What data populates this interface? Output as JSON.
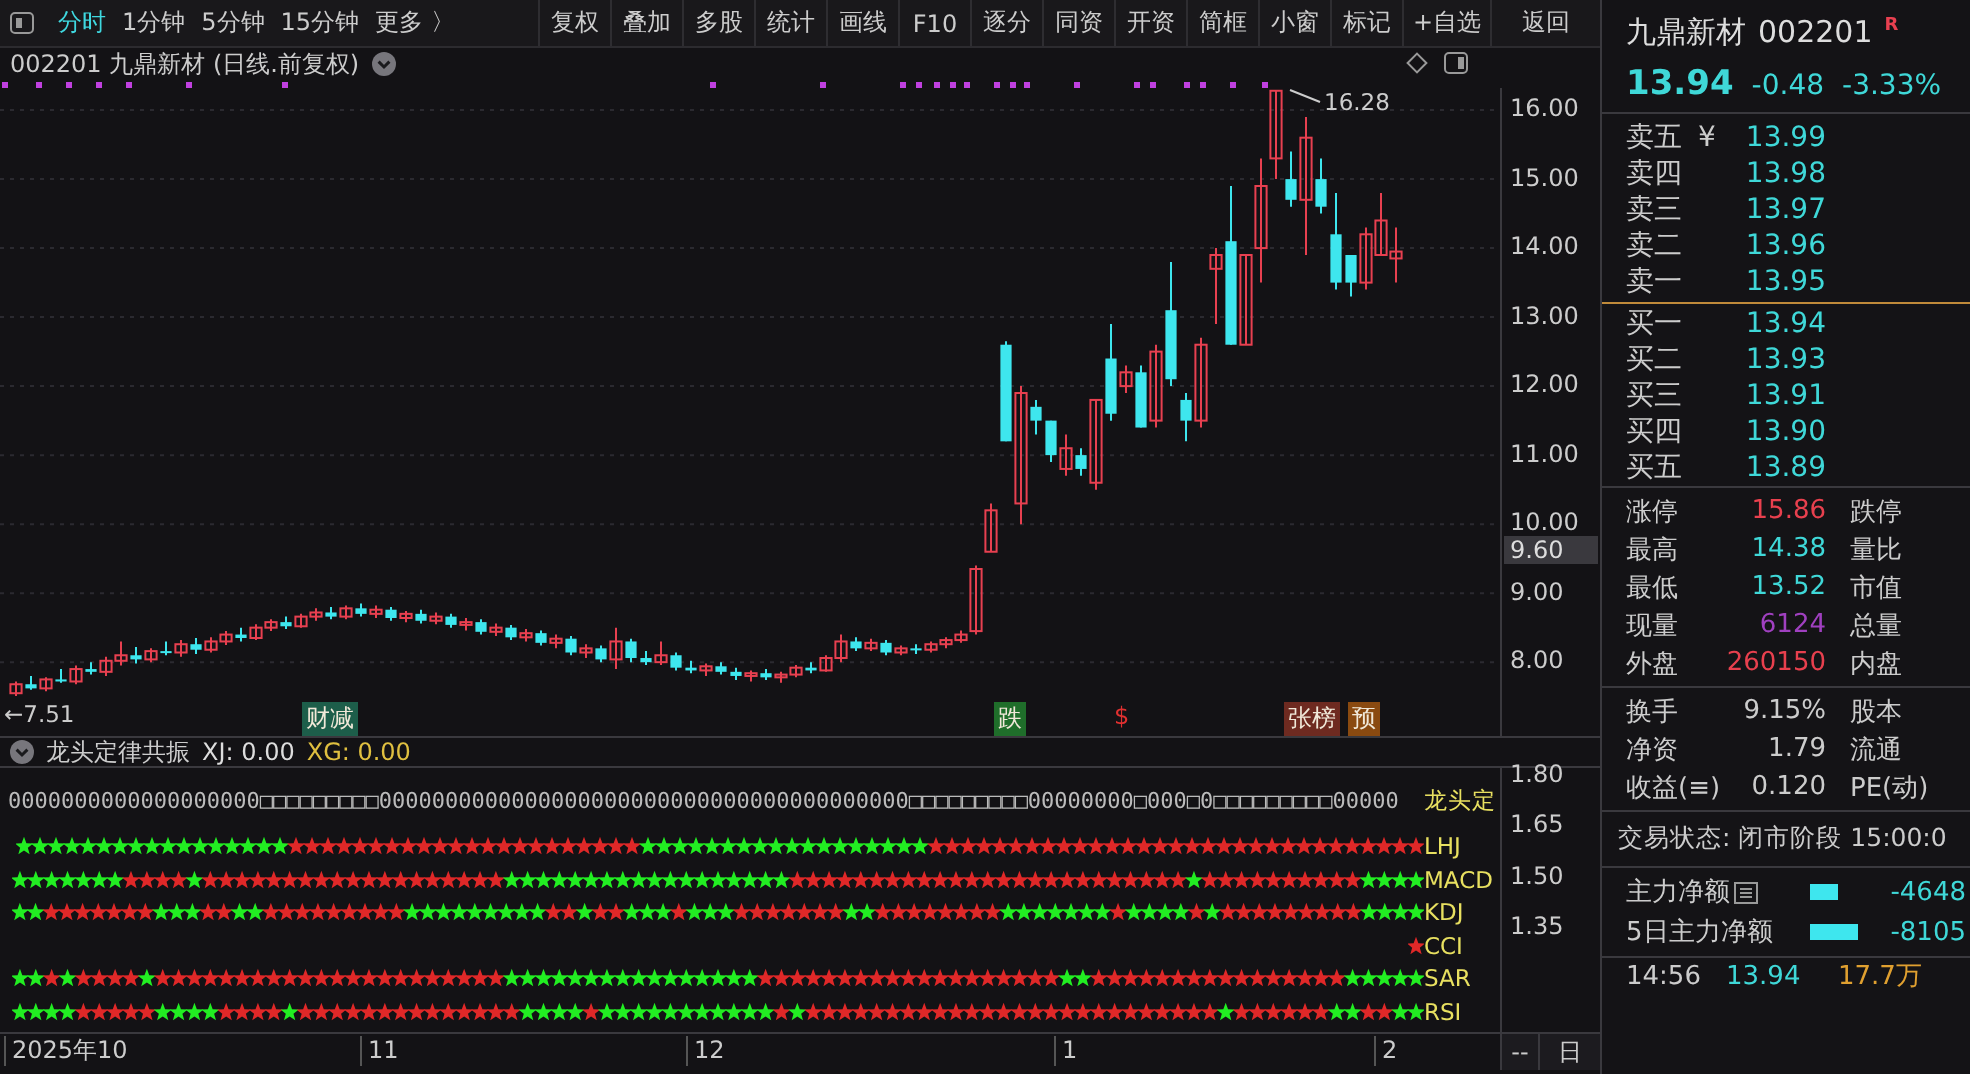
{
  "toolbar": {
    "period_tabs": [
      {
        "label": "分时",
        "selected": true
      },
      {
        "label": "1分钟",
        "selected": false
      },
      {
        "label": "5分钟",
        "selected": false
      },
      {
        "label": "15分钟",
        "selected": false
      }
    ],
    "more": "更多 〉",
    "buttons": [
      "复权",
      "叠加",
      "多股",
      "统计",
      "画线",
      "F10",
      "逐分",
      "同资",
      "开资",
      "简框",
      "小窗",
      "标记",
      "+自选"
    ],
    "back": "返回"
  },
  "chart": {
    "title": "002201 九鼎新材 (日线.前复权)",
    "current_price_tag": "9.60",
    "high_label": "16.28",
    "low_label": "←7.51",
    "chart_data": {
      "type": "candlestick",
      "ylim": [
        6.93,
        16.32
      ],
      "grid": true,
      "ohlc": [
        [
          7.55,
          7.72,
          7.51,
          7.68
        ],
        [
          7.68,
          7.8,
          7.6,
          7.62
        ],
        [
          7.62,
          7.78,
          7.58,
          7.75
        ],
        [
          7.75,
          7.9,
          7.7,
          7.72
        ],
        [
          7.72,
          7.95,
          7.68,
          7.9
        ],
        [
          7.9,
          8.0,
          7.82,
          7.86
        ],
        [
          7.86,
          8.08,
          7.8,
          8.02
        ],
        [
          8.02,
          8.3,
          7.95,
          8.1
        ],
        [
          8.1,
          8.22,
          7.98,
          8.04
        ],
        [
          8.04,
          8.2,
          8.0,
          8.16
        ],
        [
          8.16,
          8.3,
          8.1,
          8.14
        ],
        [
          8.14,
          8.32,
          8.08,
          8.26
        ],
        [
          8.26,
          8.35,
          8.12,
          8.18
        ],
        [
          8.18,
          8.36,
          8.14,
          8.3
        ],
        [
          8.3,
          8.45,
          8.25,
          8.4
        ],
        [
          8.4,
          8.5,
          8.3,
          8.35
        ],
        [
          8.35,
          8.55,
          8.32,
          8.5
        ],
        [
          8.5,
          8.62,
          8.45,
          8.58
        ],
        [
          8.58,
          8.66,
          8.48,
          8.52
        ],
        [
          8.52,
          8.7,
          8.5,
          8.66
        ],
        [
          8.66,
          8.78,
          8.6,
          8.72
        ],
        [
          8.72,
          8.8,
          8.62,
          8.66
        ],
        [
          8.66,
          8.82,
          8.62,
          8.78
        ],
        [
          8.78,
          8.85,
          8.66,
          8.7
        ],
        [
          8.7,
          8.82,
          8.64,
          8.76
        ],
        [
          8.76,
          8.8,
          8.6,
          8.64
        ],
        [
          8.64,
          8.74,
          8.58,
          8.7
        ],
        [
          8.7,
          8.76,
          8.56,
          8.6
        ],
        [
          8.6,
          8.72,
          8.55,
          8.66
        ],
        [
          8.66,
          8.7,
          8.5,
          8.54
        ],
        [
          8.54,
          8.64,
          8.46,
          8.58
        ],
        [
          8.58,
          8.62,
          8.4,
          8.44
        ],
        [
          8.44,
          8.56,
          8.38,
          8.5
        ],
        [
          8.5,
          8.54,
          8.32,
          8.36
        ],
        [
          8.36,
          8.48,
          8.3,
          8.42
        ],
        [
          8.42,
          8.46,
          8.24,
          8.28
        ],
        [
          8.28,
          8.4,
          8.2,
          8.34
        ],
        [
          8.34,
          8.38,
          8.1,
          8.14
        ],
        [
          8.14,
          8.26,
          8.06,
          8.2
        ],
        [
          8.2,
          8.24,
          8.0,
          8.04
        ],
        [
          8.04,
          8.5,
          7.9,
          8.3
        ],
        [
          8.3,
          8.34,
          8.0,
          8.06
        ],
        [
          8.06,
          8.16,
          7.96,
          8.0
        ],
        [
          8.0,
          8.3,
          7.96,
          8.1
        ],
        [
          8.1,
          8.14,
          7.88,
          7.92
        ],
        [
          7.92,
          8.02,
          7.84,
          7.88
        ],
        [
          7.88,
          7.98,
          7.8,
          7.94
        ],
        [
          7.94,
          8.0,
          7.82,
          7.86
        ],
        [
          7.86,
          7.92,
          7.74,
          7.8
        ],
        [
          7.8,
          7.88,
          7.72,
          7.84
        ],
        [
          7.84,
          7.9,
          7.74,
          7.78
        ],
        [
          7.78,
          7.86,
          7.7,
          7.82
        ],
        [
          7.82,
          7.96,
          7.78,
          7.92
        ],
        [
          7.92,
          8.0,
          7.84,
          7.88
        ],
        [
          7.88,
          8.1,
          7.86,
          8.06
        ],
        [
          8.06,
          8.4,
          8.0,
          8.3
        ],
        [
          8.3,
          8.36,
          8.16,
          8.2
        ],
        [
          8.2,
          8.34,
          8.16,
          8.28
        ],
        [
          8.28,
          8.32,
          8.1,
          8.14
        ],
        [
          8.14,
          8.24,
          8.1,
          8.2
        ],
        [
          8.2,
          8.26,
          8.12,
          8.18
        ],
        [
          8.18,
          8.3,
          8.14,
          8.26
        ],
        [
          8.26,
          8.36,
          8.2,
          8.32
        ],
        [
          8.32,
          8.46,
          8.28,
          8.4
        ],
        [
          8.45,
          9.4,
          8.4,
          9.35
        ],
        [
          9.6,
          10.3,
          9.6,
          10.2
        ],
        [
          12.6,
          12.65,
          11.2,
          11.2
        ],
        [
          10.3,
          12.0,
          10.0,
          11.9
        ],
        [
          11.7,
          11.8,
          11.3,
          11.5
        ],
        [
          11.5,
          11.5,
          10.9,
          11.0
        ],
        [
          10.8,
          11.3,
          10.7,
          11.1
        ],
        [
          11.0,
          11.1,
          10.7,
          10.8
        ],
        [
          10.6,
          11.8,
          10.5,
          11.8
        ],
        [
          12.4,
          12.9,
          11.5,
          11.6
        ],
        [
          12.0,
          12.3,
          11.9,
          12.2
        ],
        [
          12.2,
          12.3,
          11.4,
          11.4
        ],
        [
          11.5,
          12.6,
          11.4,
          12.5
        ],
        [
          13.1,
          13.8,
          12.0,
          12.1
        ],
        [
          11.8,
          11.9,
          11.2,
          11.5
        ],
        [
          11.5,
          12.7,
          11.4,
          12.6
        ],
        [
          13.7,
          14.0,
          12.9,
          13.9
        ],
        [
          14.1,
          14.9,
          12.6,
          12.6
        ],
        [
          12.6,
          13.9,
          12.6,
          13.9
        ],
        [
          14.0,
          15.3,
          13.5,
          14.9
        ],
        [
          15.3,
          16.28,
          15.0,
          16.28
        ],
        [
          15.0,
          15.4,
          14.6,
          14.7
        ],
        [
          14.7,
          15.9,
          13.9,
          15.6
        ],
        [
          15.0,
          15.3,
          14.5,
          14.6
        ],
        [
          14.2,
          14.8,
          13.4,
          13.5
        ],
        [
          13.9,
          13.9,
          13.3,
          13.5
        ],
        [
          13.5,
          14.3,
          13.4,
          14.2
        ],
        [
          13.9,
          14.8,
          13.9,
          14.4
        ],
        [
          13.85,
          14.3,
          13.5,
          13.95
        ]
      ],
      "yticks": [
        {
          "value": 16,
          "label": "16.00"
        },
        {
          "value": 15,
          "label": "15.00"
        },
        {
          "value": 14,
          "label": "14.00"
        },
        {
          "value": 13,
          "label": "13.00"
        },
        {
          "value": 12,
          "label": "12.00"
        },
        {
          "value": 11,
          "label": "11.00"
        },
        {
          "value": 10,
          "label": "10.00"
        },
        {
          "value": 9,
          "label": "9.00"
        },
        {
          "value": 8,
          "label": "8.00"
        }
      ]
    },
    "markers": [
      {
        "kind": "tag",
        "label": "财减",
        "color": "#1d5e4a"
      },
      {
        "kind": "tag",
        "label": "跌",
        "color": "#1f6e2a"
      },
      {
        "kind": "symbol",
        "label": "$",
        "color": "#e03030"
      },
      {
        "kind": "tag",
        "label": "张榜",
        "color": "#6e2a20"
      },
      {
        "kind": "tag",
        "label": "预",
        "color": "#8a4a10"
      }
    ]
  },
  "indicator": {
    "name": "龙头定律共振",
    "values": [
      {
        "kind": "plain",
        "text": "XJ: 0.00"
      },
      {
        "kind": "signal",
        "text": "XG: 0.00"
      }
    ],
    "zero_row": {
      "text": "0000000000000000000□□□□□□□□□0000000000000000000000000000000000000000□□□□□□□□□00000000□000□0□□□□□□□□□00000",
      "label": "龙头定"
    },
    "rows": [
      {
        "label": "LHJ",
        "signals": [
          {
            "color": "#22ee22"
          },
          {
            "color": "#22ee22"
          },
          {
            "color": "#22ee22"
          },
          {
            "color": "#22ee22"
          },
          {
            "color": "#22ee22"
          },
          {
            "color": "#22ee22"
          },
          {
            "color": "#22ee22"
          },
          {
            "color": "#22ee22"
          },
          {
            "color": "#22ee22"
          },
          {
            "color": "#22ee22"
          },
          {
            "color": "#22ee22"
          },
          {
            "color": "#22ee22"
          },
          {
            "color": "#22ee22"
          },
          {
            "color": "#22ee22"
          },
          {
            "color": "#22ee22"
          },
          {
            "color": "#22ee22"
          },
          {
            "color": "#22ee22"
          },
          {
            "color": "#e02828"
          },
          {
            "color": "#e02828"
          },
          {
            "color": "#e02828"
          },
          {
            "color": "#e02828"
          },
          {
            "color": "#e02828"
          },
          {
            "color": "#e02828"
          },
          {
            "color": "#e02828"
          },
          {
            "color": "#e02828"
          },
          {
            "color": "#e02828"
          },
          {
            "color": "#e02828"
          },
          {
            "color": "#e02828"
          },
          {
            "color": "#e02828"
          },
          {
            "color": "#e02828"
          },
          {
            "color": "#e02828"
          },
          {
            "color": "#e02828"
          },
          {
            "color": "#e02828"
          },
          {
            "color": "#e02828"
          },
          {
            "color": "#e02828"
          },
          {
            "color": "#e02828"
          },
          {
            "color": "#e02828"
          },
          {
            "color": "#e02828"
          },
          {
            "color": "#e02828"
          },
          {
            "color": "#22ee22"
          },
          {
            "color": "#22ee22"
          },
          {
            "color": "#22ee22"
          },
          {
            "color": "#22ee22"
          },
          {
            "color": "#22ee22"
          },
          {
            "color": "#22ee22"
          },
          {
            "color": "#22ee22"
          },
          {
            "color": "#22ee22"
          },
          {
            "color": "#22ee22"
          },
          {
            "color": "#22ee22"
          },
          {
            "color": "#22ee22"
          },
          {
            "color": "#22ee22"
          },
          {
            "color": "#22ee22"
          },
          {
            "color": "#22ee22"
          },
          {
            "color": "#22ee22"
          },
          {
            "color": "#22ee22"
          },
          {
            "color": "#22ee22"
          },
          {
            "color": "#22ee22"
          },
          {
            "color": "#e02828"
          },
          {
            "color": "#e02828"
          },
          {
            "color": "#e02828"
          },
          {
            "color": "#e02828"
          },
          {
            "color": "#e02828"
          },
          {
            "color": "#e02828"
          },
          {
            "color": "#e02828"
          },
          {
            "color": "#e02828"
          },
          {
            "color": "#e02828"
          },
          {
            "color": "#e02828"
          },
          {
            "color": "#e02828"
          },
          {
            "color": "#e02828"
          },
          {
            "color": "#e02828"
          },
          {
            "color": "#e02828"
          },
          {
            "color": "#e02828"
          },
          {
            "color": "#e02828"
          },
          {
            "color": "#e02828"
          },
          {
            "color": "#e02828"
          },
          {
            "color": "#e02828"
          },
          {
            "color": "#e02828"
          },
          {
            "color": "#e02828"
          },
          {
            "color": "#e02828"
          },
          {
            "color": "#e02828"
          },
          {
            "color": "#e02828"
          },
          {
            "color": "#e02828"
          },
          {
            "color": "#e02828"
          },
          {
            "color": "#e02828"
          },
          {
            "color": "#e02828"
          },
          {
            "color": "#e02828"
          },
          {
            "color": "#e02828"
          },
          {
            "color": "#e02828"
          }
        ]
      },
      {
        "label": "MACD",
        "signals": [
          {
            "color": "#22ee22"
          },
          {
            "color": "#22ee22"
          },
          {
            "color": "#22ee22"
          },
          {
            "color": "#22ee22"
          },
          {
            "color": "#22ee22"
          },
          {
            "color": "#22ee22"
          },
          {
            "color": "#22ee22"
          },
          {
            "color": "#e02828"
          },
          {
            "color": "#e02828"
          },
          {
            "color": "#e02828"
          },
          {
            "color": "#e02828"
          },
          {
            "color": "#22ee22"
          },
          {
            "color": "#e02828"
          },
          {
            "color": "#e02828"
          },
          {
            "color": "#e02828"
          },
          {
            "color": "#e02828"
          },
          {
            "color": "#e02828"
          },
          {
            "color": "#e02828"
          },
          {
            "color": "#e02828"
          },
          {
            "color": "#e02828"
          },
          {
            "color": "#e02828"
          },
          {
            "color": "#e02828"
          },
          {
            "color": "#e02828"
          },
          {
            "color": "#e02828"
          },
          {
            "color": "#e02828"
          },
          {
            "color": "#e02828"
          },
          {
            "color": "#e02828"
          },
          {
            "color": "#e02828"
          },
          {
            "color": "#e02828"
          },
          {
            "color": "#e02828"
          },
          {
            "color": "#e02828"
          },
          {
            "color": "#22ee22"
          },
          {
            "color": "#22ee22"
          },
          {
            "color": "#22ee22"
          },
          {
            "color": "#22ee22"
          },
          {
            "color": "#22ee22"
          },
          {
            "color": "#22ee22"
          },
          {
            "color": "#22ee22"
          },
          {
            "color": "#22ee22"
          },
          {
            "color": "#22ee22"
          },
          {
            "color": "#22ee22"
          },
          {
            "color": "#22ee22"
          },
          {
            "color": "#22ee22"
          },
          {
            "color": "#22ee22"
          },
          {
            "color": "#22ee22"
          },
          {
            "color": "#22ee22"
          },
          {
            "color": "#22ee22"
          },
          {
            "color": "#22ee22"
          },
          {
            "color": "#22ee22"
          },
          {
            "color": "#e02828"
          },
          {
            "color": "#e02828"
          },
          {
            "color": "#e02828"
          },
          {
            "color": "#e02828"
          },
          {
            "color": "#e02828"
          },
          {
            "color": "#e02828"
          },
          {
            "color": "#e02828"
          },
          {
            "color": "#e02828"
          },
          {
            "color": "#e02828"
          },
          {
            "color": "#e02828"
          },
          {
            "color": "#e02828"
          },
          {
            "color": "#e02828"
          },
          {
            "color": "#e02828"
          },
          {
            "color": "#e02828"
          },
          {
            "color": "#e02828"
          },
          {
            "color": "#e02828"
          },
          {
            "color": "#e02828"
          },
          {
            "color": "#e02828"
          },
          {
            "color": "#e02828"
          },
          {
            "color": "#e02828"
          },
          {
            "color": "#e02828"
          },
          {
            "color": "#e02828"
          },
          {
            "color": "#e02828"
          },
          {
            "color": "#e02828"
          },
          {
            "color": "#e02828"
          },
          {
            "color": "#22ee22"
          },
          {
            "color": "#e02828"
          },
          {
            "color": "#e02828"
          },
          {
            "color": "#e02828"
          },
          {
            "color": "#e02828"
          },
          {
            "color": "#e02828"
          },
          {
            "color": "#e02828"
          },
          {
            "color": "#e02828"
          },
          {
            "color": "#e02828"
          },
          {
            "color": "#e02828"
          },
          {
            "color": "#e02828"
          },
          {
            "color": "#22ee22"
          },
          {
            "color": "#22ee22"
          },
          {
            "color": "#22ee22"
          },
          {
            "color": "#22ee22"
          }
        ]
      },
      {
        "label": "KDJ",
        "signals": [
          {
            "color": "#22ee22"
          },
          {
            "color": "#22ee22"
          },
          {
            "color": "#e02828"
          },
          {
            "color": "#e02828"
          },
          {
            "color": "#e02828"
          },
          {
            "color": "#e02828"
          },
          {
            "color": "#e02828"
          },
          {
            "color": "#e02828"
          },
          {
            "color": "#e02828"
          },
          {
            "color": "#22ee22"
          },
          {
            "color": "#22ee22"
          },
          {
            "color": "#22ee22"
          },
          {
            "color": "#e02828"
          },
          {
            "color": "#e02828"
          },
          {
            "color": "#22ee22"
          },
          {
            "color": "#22ee22"
          },
          {
            "color": "#e02828"
          },
          {
            "color": "#e02828"
          },
          {
            "color": "#e02828"
          },
          {
            "color": "#e02828"
          },
          {
            "color": "#e02828"
          },
          {
            "color": "#e02828"
          },
          {
            "color": "#e02828"
          },
          {
            "color": "#e02828"
          },
          {
            "color": "#e02828"
          },
          {
            "color": "#22ee22"
          },
          {
            "color": "#22ee22"
          },
          {
            "color": "#22ee22"
          },
          {
            "color": "#22ee22"
          },
          {
            "color": "#22ee22"
          },
          {
            "color": "#22ee22"
          },
          {
            "color": "#22ee22"
          },
          {
            "color": "#22ee22"
          },
          {
            "color": "#22ee22"
          },
          {
            "color": "#e02828"
          },
          {
            "color": "#e02828"
          },
          {
            "color": "#22ee22"
          },
          {
            "color": "#e02828"
          },
          {
            "color": "#e02828"
          },
          {
            "color": "#22ee22"
          },
          {
            "color": "#22ee22"
          },
          {
            "color": "#22ee22"
          },
          {
            "color": "#e02828"
          },
          {
            "color": "#22ee22"
          },
          {
            "color": "#22ee22"
          },
          {
            "color": "#22ee22"
          },
          {
            "color": "#e02828"
          },
          {
            "color": "#e02828"
          },
          {
            "color": "#e02828"
          },
          {
            "color": "#e02828"
          },
          {
            "color": "#e02828"
          },
          {
            "color": "#e02828"
          },
          {
            "color": "#e02828"
          },
          {
            "color": "#22ee22"
          },
          {
            "color": "#22ee22"
          },
          {
            "color": "#e02828"
          },
          {
            "color": "#e02828"
          },
          {
            "color": "#e02828"
          },
          {
            "color": "#e02828"
          },
          {
            "color": "#e02828"
          },
          {
            "color": "#e02828"
          },
          {
            "color": "#e02828"
          },
          {
            "color": "#e02828"
          },
          {
            "color": "#22ee22"
          },
          {
            "color": "#22ee22"
          },
          {
            "color": "#22ee22"
          },
          {
            "color": "#22ee22"
          },
          {
            "color": "#22ee22"
          },
          {
            "color": "#22ee22"
          },
          {
            "color": "#22ee22"
          },
          {
            "color": "#e02828"
          },
          {
            "color": "#22ee22"
          },
          {
            "color": "#22ee22"
          },
          {
            "color": "#22ee22"
          },
          {
            "color": "#22ee22"
          },
          {
            "color": "#e02828"
          },
          {
            "color": "#22ee22"
          },
          {
            "color": "#e02828"
          },
          {
            "color": "#e02828"
          },
          {
            "color": "#e02828"
          },
          {
            "color": "#e02828"
          },
          {
            "color": "#e02828"
          },
          {
            "color": "#e02828"
          },
          {
            "color": "#e02828"
          },
          {
            "color": "#e02828"
          },
          {
            "color": "#e02828"
          },
          {
            "color": "#22ee22"
          },
          {
            "color": "#22ee22"
          },
          {
            "color": "#22ee22"
          },
          {
            "color": "#22ee22"
          }
        ]
      },
      {
        "label": "CCI",
        "signals": [
          {
            "color": "#e02828"
          }
        ]
      },
      {
        "label": "SAR",
        "signals": [
          {
            "color": "#22ee22"
          },
          {
            "color": "#22ee22"
          },
          {
            "color": "#e02828"
          },
          {
            "color": "#22ee22"
          },
          {
            "color": "#e02828"
          },
          {
            "color": "#e02828"
          },
          {
            "color": "#e02828"
          },
          {
            "color": "#e02828"
          },
          {
            "color": "#22ee22"
          },
          {
            "color": "#e02828"
          },
          {
            "color": "#e02828"
          },
          {
            "color": "#e02828"
          },
          {
            "color": "#e02828"
          },
          {
            "color": "#e02828"
          },
          {
            "color": "#e02828"
          },
          {
            "color": "#e02828"
          },
          {
            "color": "#e02828"
          },
          {
            "color": "#e02828"
          },
          {
            "color": "#e02828"
          },
          {
            "color": "#e02828"
          },
          {
            "color": "#e02828"
          },
          {
            "color": "#e02828"
          },
          {
            "color": "#e02828"
          },
          {
            "color": "#e02828"
          },
          {
            "color": "#e02828"
          },
          {
            "color": "#e02828"
          },
          {
            "color": "#e02828"
          },
          {
            "color": "#e02828"
          },
          {
            "color": "#e02828"
          },
          {
            "color": "#e02828"
          },
          {
            "color": "#e02828"
          },
          {
            "color": "#22ee22"
          },
          {
            "color": "#22ee22"
          },
          {
            "color": "#22ee22"
          },
          {
            "color": "#22ee22"
          },
          {
            "color": "#22ee22"
          },
          {
            "color": "#22ee22"
          },
          {
            "color": "#22ee22"
          },
          {
            "color": "#22ee22"
          },
          {
            "color": "#22ee22"
          },
          {
            "color": "#22ee22"
          },
          {
            "color": "#22ee22"
          },
          {
            "color": "#22ee22"
          },
          {
            "color": "#22ee22"
          },
          {
            "color": "#22ee22"
          },
          {
            "color": "#22ee22"
          },
          {
            "color": "#22ee22"
          },
          {
            "color": "#e02828"
          },
          {
            "color": "#e02828"
          },
          {
            "color": "#e02828"
          },
          {
            "color": "#e02828"
          },
          {
            "color": "#e02828"
          },
          {
            "color": "#e02828"
          },
          {
            "color": "#e02828"
          },
          {
            "color": "#e02828"
          },
          {
            "color": "#e02828"
          },
          {
            "color": "#e02828"
          },
          {
            "color": "#e02828"
          },
          {
            "color": "#e02828"
          },
          {
            "color": "#e02828"
          },
          {
            "color": "#e02828"
          },
          {
            "color": "#e02828"
          },
          {
            "color": "#e02828"
          },
          {
            "color": "#e02828"
          },
          {
            "color": "#e02828"
          },
          {
            "color": "#e02828"
          },
          {
            "color": "#22ee22"
          },
          {
            "color": "#22ee22"
          },
          {
            "color": "#e02828"
          },
          {
            "color": "#e02828"
          },
          {
            "color": "#e02828"
          },
          {
            "color": "#e02828"
          },
          {
            "color": "#e02828"
          },
          {
            "color": "#e02828"
          },
          {
            "color": "#e02828"
          },
          {
            "color": "#e02828"
          },
          {
            "color": "#e02828"
          },
          {
            "color": "#e02828"
          },
          {
            "color": "#e02828"
          },
          {
            "color": "#e02828"
          },
          {
            "color": "#e02828"
          },
          {
            "color": "#e02828"
          },
          {
            "color": "#e02828"
          },
          {
            "color": "#e02828"
          },
          {
            "color": "#22ee22"
          },
          {
            "color": "#22ee22"
          },
          {
            "color": "#22ee22"
          },
          {
            "color": "#22ee22"
          },
          {
            "color": "#22ee22"
          }
        ]
      },
      {
        "label": "RSI",
        "signals": [
          {
            "color": "#22ee22"
          },
          {
            "color": "#22ee22"
          },
          {
            "color": "#22ee22"
          },
          {
            "color": "#22ee22"
          },
          {
            "color": "#e02828"
          },
          {
            "color": "#e02828"
          },
          {
            "color": "#e02828"
          },
          {
            "color": "#e02828"
          },
          {
            "color": "#e02828"
          },
          {
            "color": "#22ee22"
          },
          {
            "color": "#22ee22"
          },
          {
            "color": "#22ee22"
          },
          {
            "color": "#22ee22"
          },
          {
            "color": "#e02828"
          },
          {
            "color": "#e02828"
          },
          {
            "color": "#e02828"
          },
          {
            "color": "#e02828"
          },
          {
            "color": "#22ee22"
          },
          {
            "color": "#e02828"
          },
          {
            "color": "#e02828"
          },
          {
            "color": "#e02828"
          },
          {
            "color": "#e02828"
          },
          {
            "color": "#e02828"
          },
          {
            "color": "#e02828"
          },
          {
            "color": "#e02828"
          },
          {
            "color": "#e02828"
          },
          {
            "color": "#e02828"
          },
          {
            "color": "#e02828"
          },
          {
            "color": "#e02828"
          },
          {
            "color": "#e02828"
          },
          {
            "color": "#e02828"
          },
          {
            "color": "#e02828"
          },
          {
            "color": "#22ee22"
          },
          {
            "color": "#22ee22"
          },
          {
            "color": "#22ee22"
          },
          {
            "color": "#22ee22"
          },
          {
            "color": "#e02828"
          },
          {
            "color": "#22ee22"
          },
          {
            "color": "#22ee22"
          },
          {
            "color": "#22ee22"
          },
          {
            "color": "#22ee22"
          },
          {
            "color": "#22ee22"
          },
          {
            "color": "#22ee22"
          },
          {
            "color": "#22ee22"
          },
          {
            "color": "#22ee22"
          },
          {
            "color": "#22ee22"
          },
          {
            "color": "#22ee22"
          },
          {
            "color": "#22ee22"
          },
          {
            "color": "#e02828"
          },
          {
            "color": "#22ee22"
          },
          {
            "color": "#e02828"
          },
          {
            "color": "#e02828"
          },
          {
            "color": "#e02828"
          },
          {
            "color": "#e02828"
          },
          {
            "color": "#e02828"
          },
          {
            "color": "#e02828"
          },
          {
            "color": "#e02828"
          },
          {
            "color": "#e02828"
          },
          {
            "color": "#e02828"
          },
          {
            "color": "#e02828"
          },
          {
            "color": "#e02828"
          },
          {
            "color": "#e02828"
          },
          {
            "color": "#e02828"
          },
          {
            "color": "#e02828"
          },
          {
            "color": "#e02828"
          },
          {
            "color": "#e02828"
          },
          {
            "color": "#e02828"
          },
          {
            "color": "#e02828"
          },
          {
            "color": "#e02828"
          },
          {
            "color": "#e02828"
          },
          {
            "color": "#e02828"
          },
          {
            "color": "#e02828"
          },
          {
            "color": "#e02828"
          },
          {
            "color": "#e02828"
          },
          {
            "color": "#e02828"
          },
          {
            "color": "#e02828"
          },
          {
            "color": "#22ee22"
          },
          {
            "color": "#e02828"
          },
          {
            "color": "#e02828"
          },
          {
            "color": "#e02828"
          },
          {
            "color": "#e02828"
          },
          {
            "color": "#e02828"
          },
          {
            "color": "#e02828"
          },
          {
            "color": "#22ee22"
          },
          {
            "color": "#22ee22"
          },
          {
            "color": "#e02828"
          },
          {
            "color": "#e02828"
          },
          {
            "color": "#22ee22"
          },
          {
            "color": "#22ee22"
          }
        ]
      }
    ],
    "ticks": [
      "1.80",
      "1.65",
      "1.50",
      "1.35"
    ]
  },
  "date_axis": {
    "labels": [
      "2025年10",
      "11",
      "12",
      "1",
      "2"
    ],
    "controls": [
      "--",
      "日"
    ]
  },
  "quote": {
    "name": "九鼎新材",
    "code": "002201",
    "badge": "R",
    "price": "13.94",
    "change": "-0.48",
    "change_pct": "-3.33%",
    "asks": [
      {
        "label": "卖五",
        "note": "¥",
        "price": "13.99"
      },
      {
        "label": "卖四",
        "price": "13.98"
      },
      {
        "label": "卖三",
        "price": "13.97"
      },
      {
        "label": "卖二",
        "price": "13.96"
      },
      {
        "label": "卖一",
        "price": "13.95"
      }
    ],
    "bids": [
      {
        "label": "买一",
        "price": "13.94"
      },
      {
        "label": "买二",
        "price": "13.93"
      },
      {
        "label": "买三",
        "price": "13.91"
      },
      {
        "label": "买四",
        "price": "13.90"
      },
      {
        "label": "买五",
        "price": "13.89"
      }
    ],
    "stats": [
      {
        "label": "涨停",
        "value": "15.86",
        "color": "#e8404e",
        "label2": "跌停"
      },
      {
        "label": "最高",
        "value": "14.38",
        "color": "#3fd8d8",
        "label2": "量比"
      },
      {
        "label": "最低",
        "value": "13.52",
        "color": "#3fd8d8",
        "label2": "市值"
      },
      {
        "label": "现量",
        "value": "6124",
        "color": "#a040c0",
        "label2": "总量"
      },
      {
        "label": "外盘",
        "value": "260150",
        "color": "#e8404e",
        "label2": "内盘"
      }
    ],
    "stats2": [
      {
        "label": "换手",
        "value": "9.15%",
        "label2": "股本"
      },
      {
        "label": "净资",
        "value": "1.79",
        "label2": "流通"
      },
      {
        "label": "收益(≡)",
        "value": "0.120",
        "label2": "PE(动)"
      }
    ],
    "trade_status": "交易状态: 闭市阶段 15:00:0",
    "flows": [
      {
        "label": "主力净额",
        "has_icon": true,
        "value": "-4648"
      },
      {
        "label": "5日主力净额",
        "has_icon": false,
        "value": "-8105"
      }
    ],
    "ticks": [
      {
        "time": "14:56",
        "price": "13.94",
        "volume": "17.7万"
      }
    ]
  }
}
